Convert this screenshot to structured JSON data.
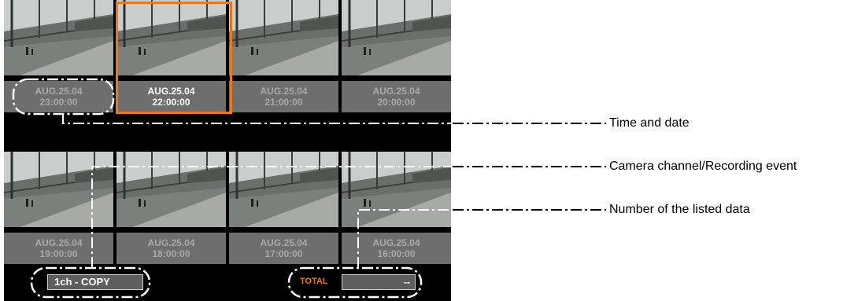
{
  "grid": [
    {
      "date": "AUG.25.04",
      "time": "23:00:00",
      "selected": false
    },
    {
      "date": "AUG.25.04",
      "time": "22:00:00",
      "selected": true
    },
    {
      "date": "AUG.25.04",
      "time": "21:00:00",
      "selected": false
    },
    {
      "date": "AUG.25.04",
      "time": "20:00:00",
      "selected": false
    },
    {
      "date": "AUG.25.04",
      "time": "19:00:00",
      "selected": false
    },
    {
      "date": "AUG.25.04",
      "time": "18:00:00",
      "selected": false
    },
    {
      "date": "AUG.25.04",
      "time": "17:00:00",
      "selected": false
    },
    {
      "date": "AUG.25.04",
      "time": "16:00:00",
      "selected": false
    }
  ],
  "footer": {
    "channel_label": "1ch - COPY",
    "total_label": "TOTAL",
    "total_value": "--"
  },
  "callouts": {
    "time_date": "Time and date",
    "channel_event": "Camera channel/Recording event",
    "listed_count": "Number of the listed data"
  },
  "colors": {
    "accent": "#e8791d",
    "panel": "#000000",
    "stamp_bg": "#6e6e6e"
  }
}
